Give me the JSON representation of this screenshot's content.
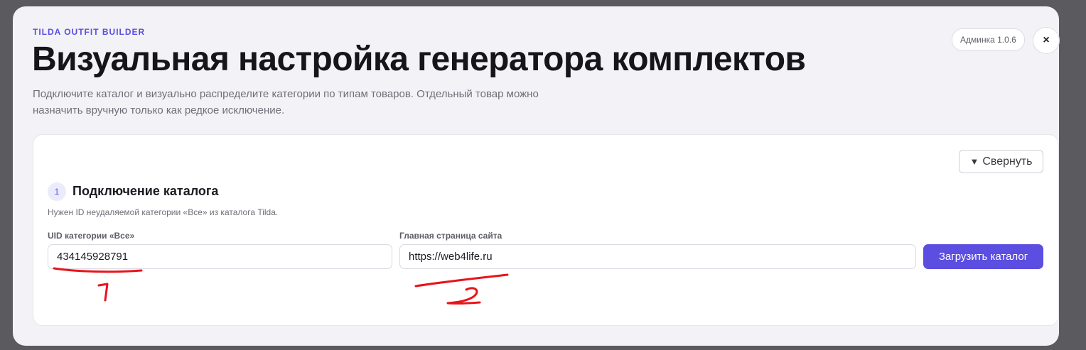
{
  "header": {
    "eyebrow": "TILDA OUTFIT BUILDER",
    "title": "Визуальная настройка генератора комплектов",
    "subtitle": "Подключите каталог и визуально распределите категории по типам товаров. Отдельный товар можно назначить вручную только как редкое исключение.",
    "version_badge": "Админка 1.0.6",
    "close_icon": "close-icon",
    "close_glyph": "×"
  },
  "catalog_section": {
    "collapse_label": "Свернуть",
    "collapse_icon": "triangle-down-icon",
    "step_number": "1",
    "title": "Подключение каталога",
    "hint": "Нужен ID неудаляемой категории «Все» из каталога Tilda.",
    "uid_field": {
      "label": "UID категории «Все»",
      "value": "434145928791"
    },
    "homepage_field": {
      "label": "Главная страница сайта",
      "value": "https://web4life.ru"
    },
    "load_button_label": "Загрузить каталог"
  },
  "annotations": {
    "color": "#e8141b",
    "marks": [
      "1",
      "2"
    ]
  }
}
